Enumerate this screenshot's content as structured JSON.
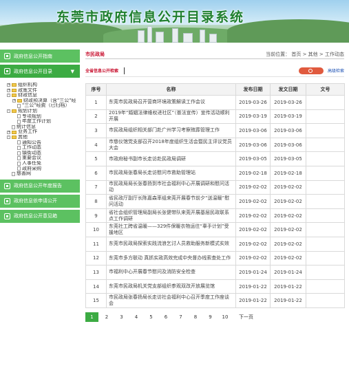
{
  "banner": {
    "title": "东莞市政府信息公开目录系统"
  },
  "left_menu": {
    "top_items": [
      {
        "label": "政府信息公开指南"
      },
      {
        "label": "政府信息公开目录"
      }
    ],
    "tree": [
      {
        "label": "组织机构",
        "level": 1,
        "kind": "folder",
        "expand": "+"
      },
      {
        "label": "政策文件",
        "level": 1,
        "kind": "folder",
        "expand": "+"
      },
      {
        "label": "财政信息",
        "level": 1,
        "kind": "folder",
        "expand": "-"
      },
      {
        "label": "财政预决算（含\"三公\"经",
        "level": 2,
        "kind": "folder",
        "expand": "+"
      },
      {
        "label": "\"三公\"经费（已归档）",
        "level": 2,
        "kind": "file",
        "expand": ""
      },
      {
        "label": "规划计划",
        "level": 1,
        "kind": "folder",
        "expand": "-"
      },
      {
        "label": "专项规划",
        "level": 2,
        "kind": "file",
        "expand": ""
      },
      {
        "label": "年度工作计划",
        "level": 2,
        "kind": "file",
        "expand": ""
      },
      {
        "label": "统计信息",
        "level": 1,
        "kind": "file",
        "expand": ""
      },
      {
        "label": "业务工作",
        "level": 1,
        "kind": "folder",
        "expand": "+"
      },
      {
        "label": "其他",
        "level": 1,
        "kind": "folder",
        "expand": "-"
      },
      {
        "label": "通知公告",
        "level": 2,
        "kind": "file",
        "expand": ""
      },
      {
        "label": "工作动态",
        "level": 2,
        "kind": "file",
        "expand": ""
      },
      {
        "label": "镇街动态",
        "level": 2,
        "kind": "file",
        "expand": ""
      },
      {
        "label": "重要会议",
        "level": 2,
        "kind": "file",
        "expand": ""
      },
      {
        "label": "人事任免",
        "level": 2,
        "kind": "file",
        "expand": ""
      },
      {
        "label": "政府采购",
        "level": 2,
        "kind": "file",
        "expand": ""
      },
      {
        "label": "慈善网",
        "level": 1,
        "kind": "file",
        "expand": ""
      }
    ],
    "bottom_items": [
      {
        "label": "政府信息公开年度报告"
      },
      {
        "label": "政府信息依申请公开"
      },
      {
        "label": "政府信息公开意见箱"
      }
    ]
  },
  "main": {
    "section_title": "市民政局",
    "breadcrumb": "当前位置： 首页 > 其他 > 工作动态",
    "search": {
      "label": "全省信息公开检索",
      "placeholder": "",
      "advanced": "高级检索"
    },
    "table": {
      "headers": [
        "序号",
        "名称",
        "发布日期",
        "发文日期",
        "文号"
      ],
      "rows": [
        [
          "1",
          "东莞市民政局召开营商环境政策解读工作会议",
          "2019-03-26",
          "2019-03-26",
          ""
        ],
        [
          "2",
          "2019年“婚姻法律维权进社区”（普法宣传）宣传活动顺利开展",
          "2019-03-19",
          "2019-03-19",
          ""
        ],
        [
          "3",
          "市民政局组织相关部门赴广州学习考察殡葬管理工作",
          "2019-03-06",
          "2019-03-06",
          ""
        ],
        [
          "4",
          "市慈仪馆党支部召开2018年度组织生活会暨民主评议党员大会",
          "2019-03-06",
          "2019-03-06",
          ""
        ],
        [
          "5",
          "市政府秘书副市长走访赴民政局调研",
          "2019-03-05",
          "2019-03-05",
          ""
        ],
        [
          "6",
          "市民政局张春局长走访慰问市救助管理站",
          "2019-02-18",
          "2019-02-18",
          ""
        ],
        [
          "7",
          "市民政局局长张春扬到市社会福利中心开展调研和慰问活动",
          "2019-02-02",
          "2019-02-02",
          ""
        ],
        [
          "8",
          "省民政厅副厅长陈嘉森率组来莞开展春节前夕“送温暖”慰问活动",
          "2019-02-02",
          "2019-02-02",
          ""
        ],
        [
          "9",
          "省社会组织管理局副局长张健带队来莞开展基层民政联系点工作调研",
          "2019-02-02",
          "2019-02-02",
          ""
        ],
        [
          "10",
          "东莞社工跨省温暖——329件保暖衣物运往“辜手计划”受援地区",
          "2019-02-02",
          "2019-02-02",
          ""
        ],
        [
          "11",
          "东莞市民政局探索实践流浪乞讨人员救助服务新模式实效",
          "2019-02-02",
          "2019-02-02",
          ""
        ],
        [
          "12",
          "东莞市多方联动 真抓实政高效完成中央督办线索查处工作",
          "2019-02-02",
          "2019-02-02",
          ""
        ],
        [
          "13",
          "市福利中心开展春节慰问及消防安全检查",
          "2019-01-24",
          "2019-01-24",
          ""
        ],
        [
          "14",
          "东莞市民政局机关党支部组织参观双改开放展览馆",
          "2019-01-22",
          "2019-01-22",
          ""
        ],
        [
          "15",
          "市民政局张春扬局长走访社会福利中心召开季度工作座谈会",
          "2019-01-22",
          "2019-01-22",
          ""
        ]
      ]
    },
    "pager": {
      "pages": [
        "1",
        "2",
        "3",
        "4",
        "5",
        "6",
        "7",
        "8",
        "9",
        "10"
      ],
      "current": "1",
      "next": "下一页"
    }
  },
  "colors": {
    "green": "#3cab43",
    "red": "#c8102e",
    "link_blue": "#1a4fb3"
  }
}
